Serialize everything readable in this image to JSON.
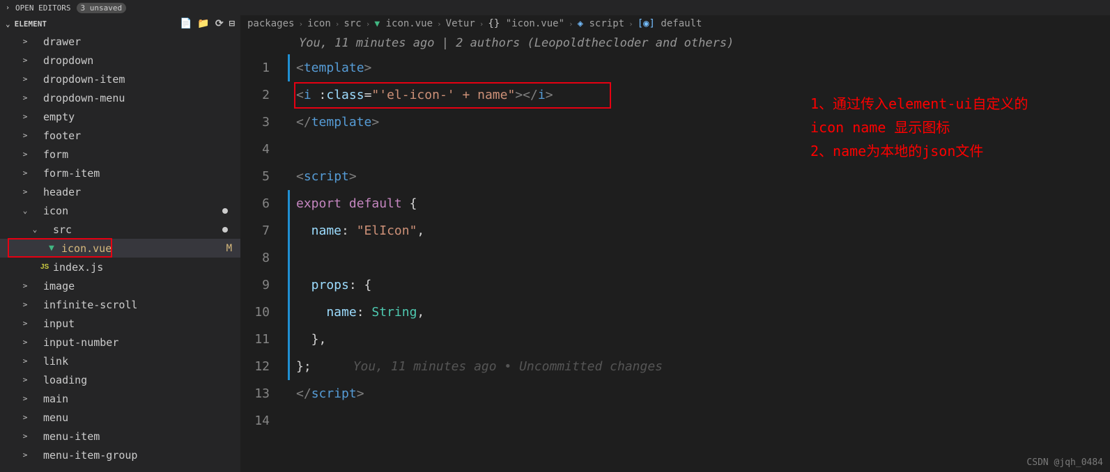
{
  "topbar": {
    "open_editors_label": "OPEN EDITORS",
    "unsaved_badge": "3 unsaved"
  },
  "sidebar": {
    "title": "ELEMENT",
    "items": [
      {
        "label": "drawer",
        "indent": 1,
        "chevron": ">"
      },
      {
        "label": "dropdown",
        "indent": 1,
        "chevron": ">"
      },
      {
        "label": "dropdown-item",
        "indent": 1,
        "chevron": ">"
      },
      {
        "label": "dropdown-menu",
        "indent": 1,
        "chevron": ">"
      },
      {
        "label": "empty",
        "indent": 1,
        "chevron": ">"
      },
      {
        "label": "footer",
        "indent": 1,
        "chevron": ">"
      },
      {
        "label": "form",
        "indent": 1,
        "chevron": ">"
      },
      {
        "label": "form-item",
        "indent": 1,
        "chevron": ">"
      },
      {
        "label": "header",
        "indent": 1,
        "chevron": ">"
      },
      {
        "label": "icon",
        "indent": 1,
        "chevron": "⌄",
        "dot": true
      },
      {
        "label": "src",
        "indent": 2,
        "chevron": "⌄",
        "dot": true
      },
      {
        "label": "icon.vue",
        "indent": 3,
        "chevron": "",
        "file": "vue",
        "status": "M",
        "selected": true,
        "redbox": true
      },
      {
        "label": "index.js",
        "indent": 2,
        "chevron": "",
        "file": "js"
      },
      {
        "label": "image",
        "indent": 1,
        "chevron": ">"
      },
      {
        "label": "infinite-scroll",
        "indent": 1,
        "chevron": ">"
      },
      {
        "label": "input",
        "indent": 1,
        "chevron": ">"
      },
      {
        "label": "input-number",
        "indent": 1,
        "chevron": ">"
      },
      {
        "label": "link",
        "indent": 1,
        "chevron": ">"
      },
      {
        "label": "loading",
        "indent": 1,
        "chevron": ">"
      },
      {
        "label": "main",
        "indent": 1,
        "chevron": ">"
      },
      {
        "label": "menu",
        "indent": 1,
        "chevron": ">"
      },
      {
        "label": "menu-item",
        "indent": 1,
        "chevron": ">"
      },
      {
        "label": "menu-item-group",
        "indent": 1,
        "chevron": ">"
      }
    ]
  },
  "breadcrumbs": [
    {
      "label": "packages"
    },
    {
      "label": "icon"
    },
    {
      "label": "src"
    },
    {
      "label": "icon.vue",
      "icon": "vue"
    },
    {
      "label": "Vetur"
    },
    {
      "label": "\"icon.vue\"",
      "icon": "brace"
    },
    {
      "label": "script",
      "icon": "cube"
    },
    {
      "label": "default",
      "icon": "var"
    }
  ],
  "gitlens_top": "You, 11 minutes ago | 2 authors (Leopoldthecloder and others)",
  "code": {
    "lines_count": 14,
    "line1_tag_open": "<",
    "line1_tag": "template",
    "line1_close": ">",
    "line2_open": "<",
    "line2_tag": "i",
    "line2_sp": " ",
    "line2_colon": ":",
    "line2_attr": "class",
    "line2_eq": "=",
    "line2_str": "\"'el-icon-' + name\"",
    "line2_gt": ">",
    "line2_end_open": "</",
    "line2_end_tag": "i",
    "line2_end_gt": ">",
    "line3_open": "</",
    "line3_tag": "template",
    "line3_gt": ">",
    "line5_open": "<",
    "line5_tag": "script",
    "line5_gt": ">",
    "line6_export": "export",
    "line6_sp": " ",
    "line6_default": "default",
    "line6_brace": " {",
    "line7_name": "  name",
    "line7_colon": ": ",
    "line7_str": "\"ElIcon\"",
    "line7_comma": ",",
    "line9_props": "  props",
    "line9_colon": ": {",
    "line10_name": "    name",
    "line10_colon": ": ",
    "line10_type": "String",
    "line10_comma": ",",
    "line11_brace": "  },",
    "line12_brace": "};",
    "line12_lens": "You, 11 minutes ago • Uncommitted changes",
    "line13_open": "</",
    "line13_tag": "script",
    "line13_gt": ">"
  },
  "annotations": {
    "line1": "1、通过传入element-ui自定义的",
    "line2": "icon name 显示图标",
    "line3": "2、name为本地的json文件"
  },
  "watermark": "CSDN @jqh_0484"
}
